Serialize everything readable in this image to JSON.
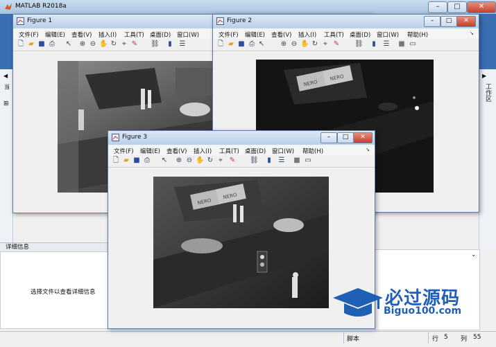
{
  "main": {
    "title": "MATLAB R2018a",
    "window_buttons": {
      "minimize": "–",
      "maximize": "□",
      "close": "✕"
    },
    "left_strip": {
      "arrow": "◀",
      "label": "当",
      "plus": "⊞"
    },
    "workspace_tab": "工作区",
    "details_header": "详细信息",
    "details_text": "选择文件以查看详细信息",
    "status": {
      "mode": "脚本",
      "row_label": "行",
      "row": "5",
      "col_label": "列",
      "col": "55"
    }
  },
  "figure_menu": {
    "file": "文件(F)",
    "edit": "编辑(E)",
    "view": "查看(V)",
    "insert": "插入(I)",
    "tools": "工具(T)",
    "desktop": "桌面(D)",
    "window": "窗口(W)",
    "help": "帮助(H)"
  },
  "figures": [
    {
      "title": "Figure 1"
    },
    {
      "title": "Figure 2"
    },
    {
      "title": "Figure 3"
    }
  ],
  "toolbar_icons": [
    "new-file-icon",
    "open-folder-icon",
    "save-icon",
    "print-icon",
    "pointer-icon",
    "zoom-in-icon",
    "zoom-out-icon",
    "pan-icon",
    "rotate-icon",
    "data-cursor-icon",
    "brush-icon",
    "link-icon",
    "colorbar-icon",
    "legend-icon",
    "hide-tools-icon",
    "show-tools-icon"
  ],
  "image_signs": {
    "sign_a": "NERO",
    "sign_b": "NERO"
  },
  "logo": {
    "title": "必过源码",
    "url": "Biguo100.com"
  },
  "colors": {
    "accent": "#1f5fb4",
    "ribbon": "#3c6eb4"
  }
}
